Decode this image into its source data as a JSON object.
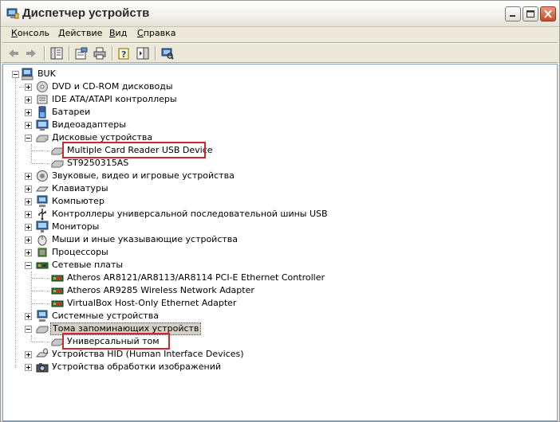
{
  "window": {
    "title": "Диспетчер устройств",
    "minimize_icon": "minimize-icon",
    "maximize_icon": "maximize-icon",
    "close_icon": "close-icon"
  },
  "menu": {
    "items": [
      {
        "label": "Консоль",
        "underline": "К"
      },
      {
        "label": "Действие",
        "underline": "Д"
      },
      {
        "label": "Вид",
        "underline": "В"
      },
      {
        "label": "Справка",
        "underline": "С"
      }
    ]
  },
  "toolbar": {
    "buttons": [
      "back-icon",
      "forward-icon",
      "tree-view-icon",
      "properties-icon",
      "print-icon",
      "help-icon",
      "show-hide-icon",
      "scan-hardware-icon"
    ]
  },
  "tree": {
    "root": "BUK",
    "items": [
      {
        "label": "DVD и CD-ROM дисководы"
      },
      {
        "label": "IDE ATA/ATAPI контроллеры"
      },
      {
        "label": "Батареи"
      },
      {
        "label": "Видеоадаптеры"
      },
      {
        "label": "Дисковые устройства"
      },
      {
        "label": "Multiple Card  Reader USB Device"
      },
      {
        "label": "ST9250315AS"
      },
      {
        "label": "Звуковые, видео и игровые устройства"
      },
      {
        "label": "Клавиатуры"
      },
      {
        "label": "Компьютер"
      },
      {
        "label": "Контроллеры универсальной последовательной шины USB"
      },
      {
        "label": "Мониторы"
      },
      {
        "label": "Мыши и иные указывающие устройства"
      },
      {
        "label": "Процессоры"
      },
      {
        "label": "Сетевые платы"
      },
      {
        "label": "Atheros AR8121/AR8113/AR8114 PCI-E Ethernet Controller"
      },
      {
        "label": "Atheros AR9285 Wireless Network Adapter"
      },
      {
        "label": "VirtualBox Host-Only Ethernet Adapter"
      },
      {
        "label": "Системные устройства"
      },
      {
        "label": "Тома запоминающих устройств"
      },
      {
        "label": "Универсальный том"
      },
      {
        "label": "Устройства HID (Human Interface Devices)"
      },
      {
        "label": "Устройства обработки изображений"
      }
    ]
  },
  "highlight_color": "#D5242B"
}
